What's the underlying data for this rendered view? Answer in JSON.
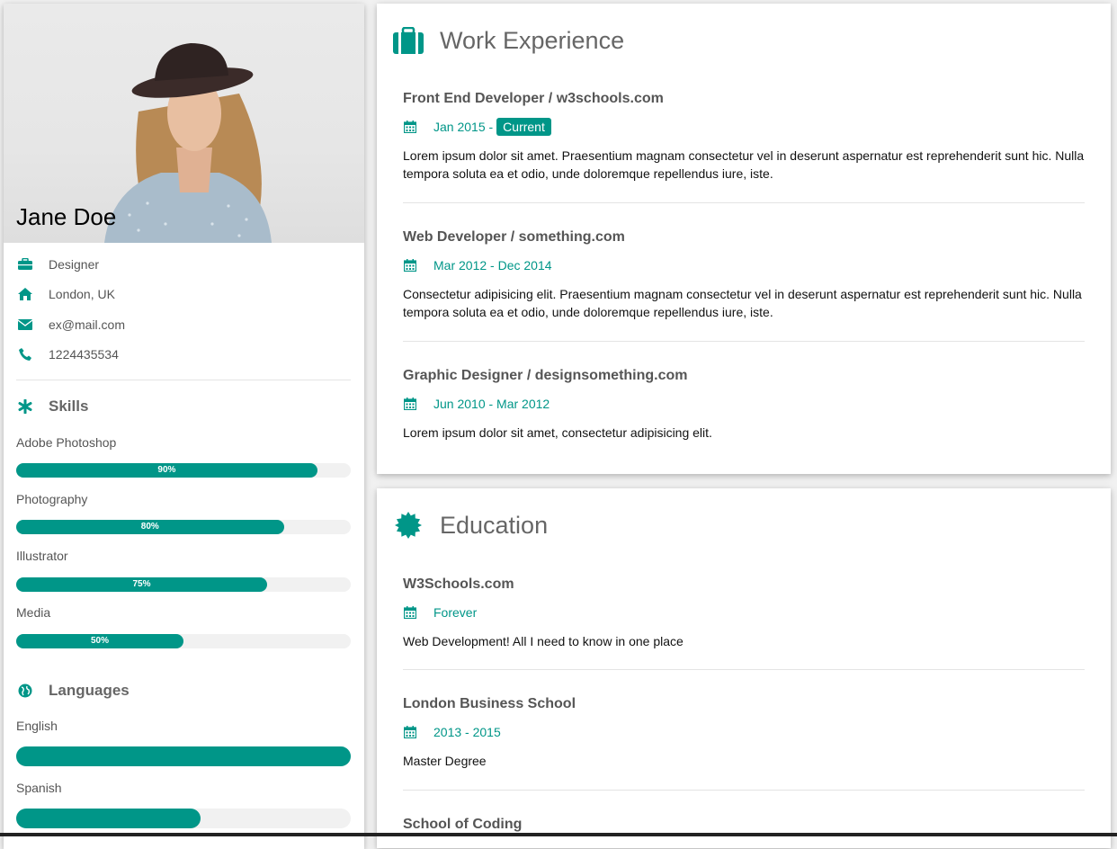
{
  "colors": {
    "accent": "#009688",
    "bar_track": "#f1f1f1",
    "page_bg": "#f1f1f1"
  },
  "profile": {
    "name": "Jane Doe",
    "info": [
      {
        "icon": "briefcase-icon",
        "text": "Designer"
      },
      {
        "icon": "home-icon",
        "text": "London, UK"
      },
      {
        "icon": "envelope-icon",
        "text": "ex@mail.com"
      },
      {
        "icon": "phone-icon",
        "text": "1224435534"
      }
    ]
  },
  "skills": {
    "title": "Skills",
    "icon": "asterisk-icon",
    "items": [
      {
        "label": "Adobe Photoshop",
        "percent": 90,
        "text": "90%"
      },
      {
        "label": "Photography",
        "percent": 80,
        "text": "80%"
      },
      {
        "label": "Illustrator",
        "percent": 75,
        "text": "75%"
      },
      {
        "label": "Media",
        "percent": 50,
        "text": "50%"
      }
    ]
  },
  "languages": {
    "title": "Languages",
    "icon": "globe-icon",
    "items": [
      {
        "label": "English",
        "percent": 100
      },
      {
        "label": "Spanish",
        "percent": 55
      }
    ]
  },
  "work": {
    "title": "Work Experience",
    "icon": "suitcase-icon",
    "entries": [
      {
        "title": "Front End Developer / w3schools.com",
        "date": "Jan 2015 -",
        "tag": "Current",
        "desc": "Lorem ipsum dolor sit amet. Praesentium magnam consectetur vel in deserunt aspernatur est reprehenderit sunt hic. Nulla tempora soluta ea et odio, unde doloremque repellendus iure, iste."
      },
      {
        "title": "Web Developer / something.com",
        "date": "Mar 2012 - Dec 2014",
        "desc": "Consectetur adipisicing elit. Praesentium magnam consectetur vel in deserunt aspernatur est reprehenderit sunt hic. Nulla tempora soluta ea et odio, unde doloremque repellendus iure, iste."
      },
      {
        "title": "Graphic Designer / designsomething.com",
        "date": "Jun 2010 - Mar 2012",
        "desc": "Lorem ipsum dolor sit amet, consectetur adipisicing elit."
      }
    ]
  },
  "education": {
    "title": "Education",
    "icon": "certificate-icon",
    "entries": [
      {
        "title": "W3Schools.com",
        "date": "Forever",
        "desc": "Web Development! All I need to know in one place"
      },
      {
        "title": "London Business School",
        "date": "2013 - 2015",
        "desc": "Master Degree"
      },
      {
        "title": "School of Coding"
      }
    ]
  }
}
